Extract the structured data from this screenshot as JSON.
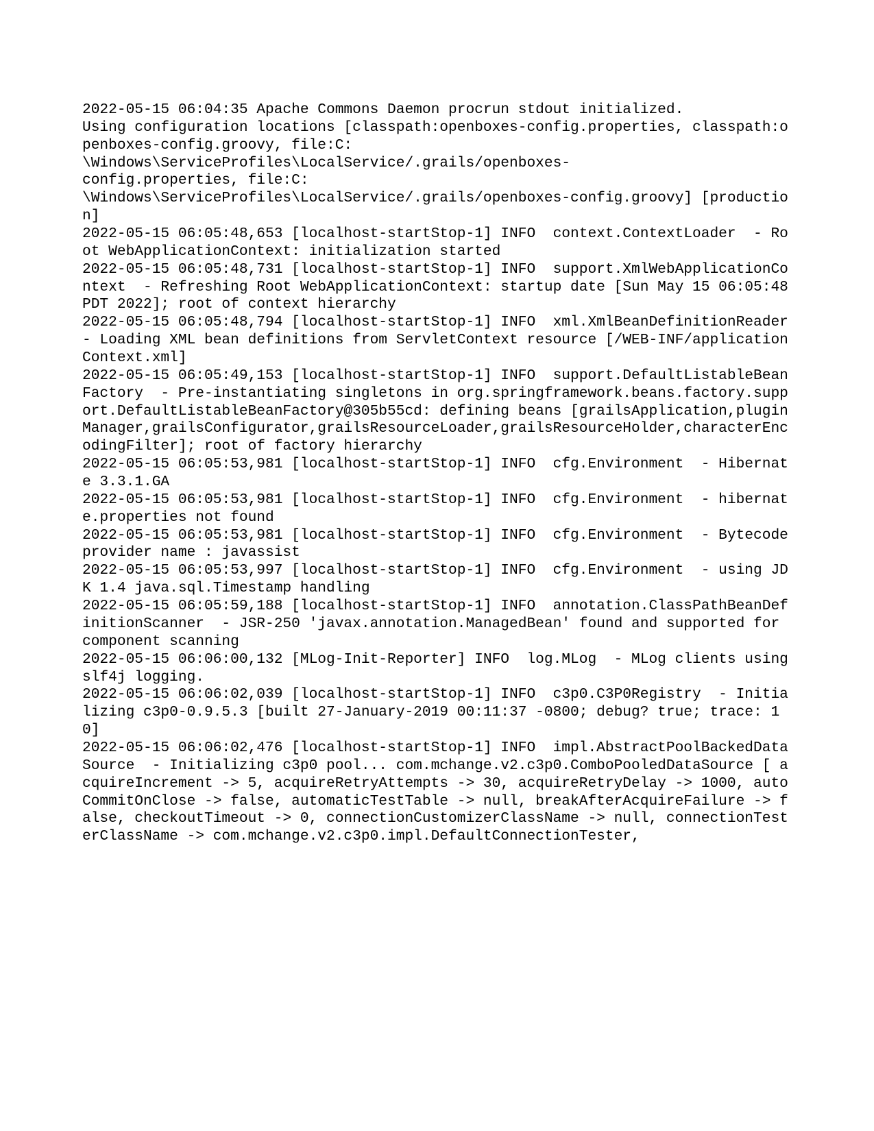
{
  "log": {
    "lines": [
      "2022-05-15 06:04:35 Apache Commons Daemon procrun stdout initialized.",
      "Using configuration locations [classpath:openboxes-config.properties, classpath:openboxes-config.groovy, file:C:",
      "\\Windows\\ServiceProfiles\\LocalService/.grails/openboxes-",
      "config.properties, file:C:",
      "\\Windows\\ServiceProfiles\\LocalService/.grails/openboxes-config.groovy] [production]",
      "2022-05-15 06:05:48,653 [localhost-startStop-1] INFO  context.ContextLoader  - Root WebApplicationContext: initialization started",
      "2022-05-15 06:05:48,731 [localhost-startStop-1] INFO  support.XmlWebApplicationContext  - Refreshing Root WebApplicationContext: startup date [Sun May 15 06:05:48 PDT 2022]; root of context hierarchy",
      "2022-05-15 06:05:48,794 [localhost-startStop-1] INFO  xml.XmlBeanDefinitionReader  - Loading XML bean definitions from ServletContext resource [/WEB-INF/applicationContext.xml]",
      "2022-05-15 06:05:49,153 [localhost-startStop-1] INFO  support.DefaultListableBeanFactory  - Pre-instantiating singletons in org.springframework.beans.factory.support.DefaultListableBeanFactory@305b55cd: defining beans [grailsApplication,pluginManager,grailsConfigurator,grailsResourceLoader,grailsResourceHolder,characterEncodingFilter]; root of factory hierarchy",
      "2022-05-15 06:05:53,981 [localhost-startStop-1] INFO  cfg.Environment  - Hibernate 3.3.1.GA",
      "2022-05-15 06:05:53,981 [localhost-startStop-1] INFO  cfg.Environment  - hibernate.properties not found",
      "2022-05-15 06:05:53,981 [localhost-startStop-1] INFO  cfg.Environment  - Bytecode provider name : javassist",
      "2022-05-15 06:05:53,997 [localhost-startStop-1] INFO  cfg.Environment  - using JDK 1.4 java.sql.Timestamp handling",
      "2022-05-15 06:05:59,188 [localhost-startStop-1] INFO  annotation.ClassPathBeanDefinitionScanner  - JSR-250 'javax.annotation.ManagedBean' found and supported for component scanning",
      "2022-05-15 06:06:00,132 [MLog-Init-Reporter] INFO  log.MLog  - MLog clients using slf4j logging.",
      "2022-05-15 06:06:02,039 [localhost-startStop-1] INFO  c3p0.C3P0Registry  - Initializing c3p0-0.9.5.3 [built 27-January-2019 00:11:37 -0800; debug? true; trace: 10]",
      "2022-05-15 06:06:02,476 [localhost-startStop-1] INFO  impl.AbstractPoolBackedDataSource  - Initializing c3p0 pool... com.mchange.v2.c3p0.ComboPooledDataSource [ acquireIncrement -> 5, acquireRetryAttempts -> 30, acquireRetryDelay -> 1000, autoCommitOnClose -> false, automaticTestTable -> null, breakAfterAcquireFailure -> false, checkoutTimeout -> 0, connectionCustomizerClassName -> null, connectionTesterClassName -> com.mchange.v2.c3p0.impl.DefaultConnectionTester,"
    ]
  }
}
